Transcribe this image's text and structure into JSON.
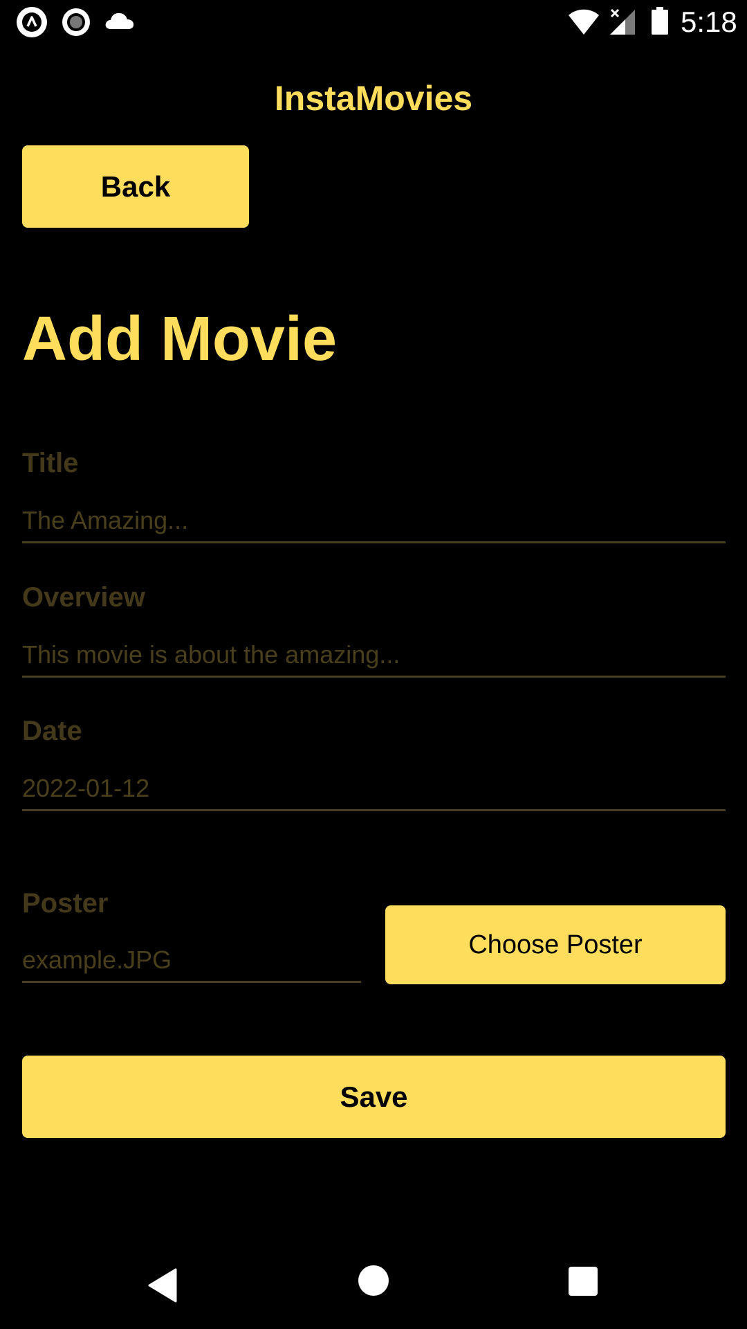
{
  "status_bar": {
    "time": "5:18",
    "left_icons": [
      "app-a-icon",
      "record-icon",
      "cloud-icon"
    ],
    "right_icons": [
      "wifi-icon",
      "cellular-signal-icon",
      "battery-icon"
    ]
  },
  "header": {
    "app_title": "InstaMovies",
    "back_label": "Back"
  },
  "page": {
    "heading": "Add Movie"
  },
  "form": {
    "title": {
      "label": "Title",
      "placeholder": "The Amazing..."
    },
    "overview": {
      "label": "Overview",
      "placeholder": "This movie is about the amazing..."
    },
    "date": {
      "label": "Date",
      "placeholder": "2022-01-12"
    },
    "poster": {
      "label": "Poster",
      "placeholder": "example.JPG",
      "choose_label": "Choose Poster"
    },
    "save_label": "Save"
  },
  "nav_bar": {
    "icons": [
      "back-icon",
      "home-icon",
      "recents-icon"
    ]
  },
  "colors": {
    "background": "#000000",
    "accent": "#FFDD5C",
    "muted_label": "#44391A",
    "underline": "#4A3F1C",
    "button_text": "#000000"
  }
}
